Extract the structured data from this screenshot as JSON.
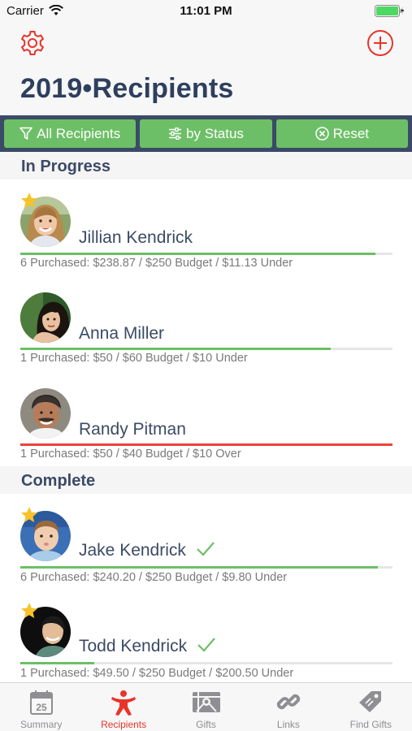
{
  "status_bar": {
    "carrier": "Carrier",
    "time": "11:01 PM"
  },
  "header": {
    "title": "2019•Recipients",
    "settings_icon": "gear-icon",
    "add_icon": "plus-circle-icon",
    "accent": "#e8342a"
  },
  "filters": [
    {
      "label": "All Recipients",
      "icon": "filter-icon"
    },
    {
      "label": "by Status",
      "icon": "sliders-icon"
    },
    {
      "label": "Reset",
      "icon": "x-circle-icon"
    }
  ],
  "sections": {
    "in_progress": {
      "title": "In Progress",
      "items": [
        {
          "name": "Jillian Kendrick",
          "starred": true,
          "progress": 0.955,
          "status_color": "#6dbf67",
          "detail": "6 Purchased: $238.87 / $250 Budget / $11.13 Under"
        },
        {
          "name": "Anna Miller",
          "starred": false,
          "progress": 0.833,
          "status_color": "#6dbf67",
          "detail": "1 Purchased: $50 / $60 Budget / $10 Under"
        },
        {
          "name": "Randy Pitman",
          "starred": false,
          "progress": 1.0,
          "status_color": "#e8453c",
          "detail": "1 Purchased: $50 / $40 Budget / $10 Over"
        }
      ]
    },
    "complete": {
      "title": "Complete",
      "items": [
        {
          "name": "Jake Kendrick",
          "starred": true,
          "progress": 0.961,
          "status_color": "#6dbf67",
          "detail": "6 Purchased: $240.20 / $250 Budget / $9.80 Under"
        },
        {
          "name": "Todd Kendrick",
          "starred": true,
          "progress": 0.198,
          "status_color": "#6dbf67",
          "detail": "1 Purchased: $49.50 / $250 Budget / $200.50 Under"
        }
      ]
    }
  },
  "tab_bar": {
    "tabs": [
      {
        "label": "Summary",
        "icon": "calendar-icon",
        "badge": "25"
      },
      {
        "label": "Recipients",
        "icon": "person-icon",
        "active": true
      },
      {
        "label": "Gifts",
        "icon": "gift-icon"
      },
      {
        "label": "Links",
        "icon": "link-icon"
      },
      {
        "label": "Find Gifts",
        "icon": "tag-icon"
      }
    ]
  }
}
